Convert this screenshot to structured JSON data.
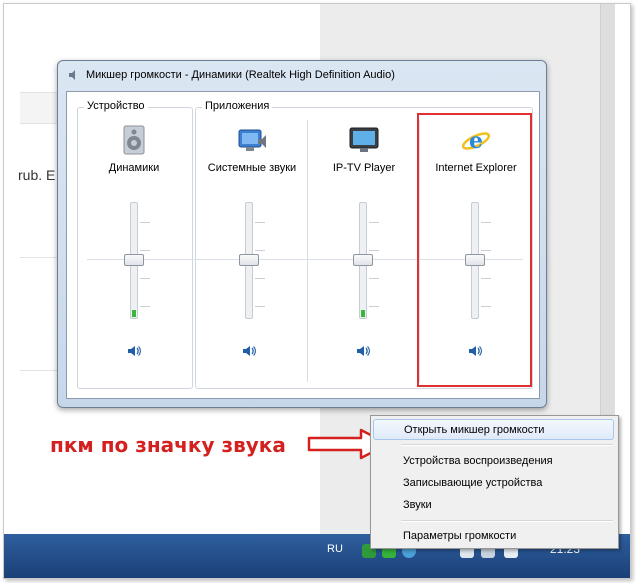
{
  "window": {
    "title": "Микшер громкости - Динамики (Realtek High Definition Audio)",
    "device_group_label": "Устройство",
    "apps_group_label": "Приложения"
  },
  "channels": [
    {
      "label": "Динамики",
      "icon": "speaker-device-icon",
      "level": 0.5,
      "peak": 0.06
    },
    {
      "label": "Системные звуки",
      "icon": "system-sounds-icon",
      "level": 0.5,
      "peak": 0
    },
    {
      "label": "IP-TV Player",
      "icon": "tv-monitor-icon",
      "level": 0.5,
      "peak": 0.06
    },
    {
      "label": "Internet Explorer",
      "icon": "internet-explorer-icon",
      "level": 0.5,
      "peak": 0
    }
  ],
  "background": {
    "partial_text": "rub. E"
  },
  "annotation": {
    "text": "пкм по значку  звука",
    "color": "#d52020"
  },
  "context_menu": {
    "items": [
      "Открыть микшер громкости",
      "Устройства воспроизведения",
      "Записывающие устройства",
      "Звуки",
      "Параметры громкости"
    ]
  },
  "taskbar": {
    "language": "RU",
    "time": "21:23"
  },
  "colors": {
    "highlight_border": "#e03030",
    "meter_green": "#3bb53b",
    "taskbar": "#1b3f77"
  }
}
